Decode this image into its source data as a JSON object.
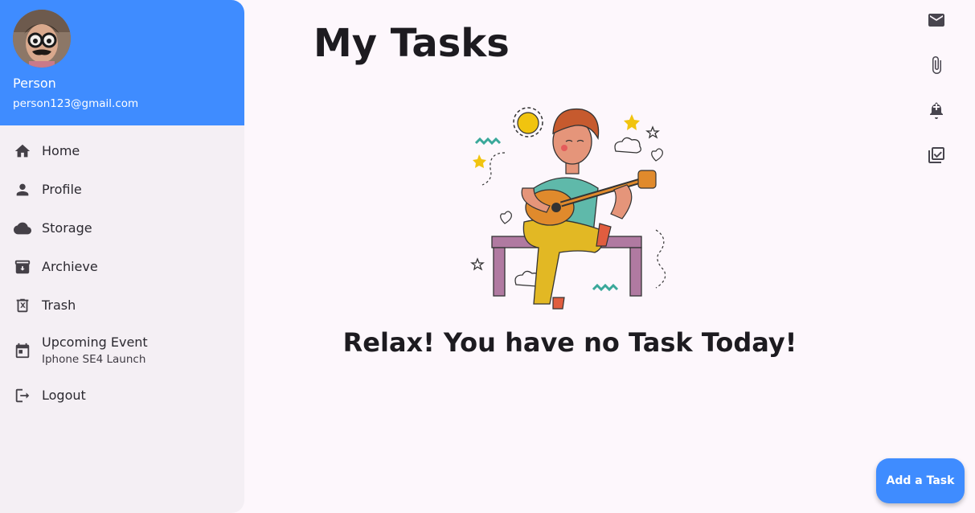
{
  "page": {
    "title": "My Tasks",
    "empty_message": "Relax! You have no Task Today!"
  },
  "user": {
    "name": "Person",
    "email": "person123@gmail.com"
  },
  "nav": {
    "home": "Home",
    "profile": "Profile",
    "storage": "Storage",
    "archive": "Archieve",
    "trash": "Trash",
    "event": {
      "label": "Upcoming Event",
      "sub": "Iphone SE4 Launch"
    },
    "logout": "Logout"
  },
  "rail_icons": [
    "mail-icon",
    "attachment-icon",
    "bell-plus-icon",
    "checklist-icon"
  ],
  "fab": {
    "label": "Add a Task"
  },
  "colors": {
    "accent": "#3f8cff",
    "background": "#fdf7fc",
    "drawer": "#f4eff4"
  }
}
